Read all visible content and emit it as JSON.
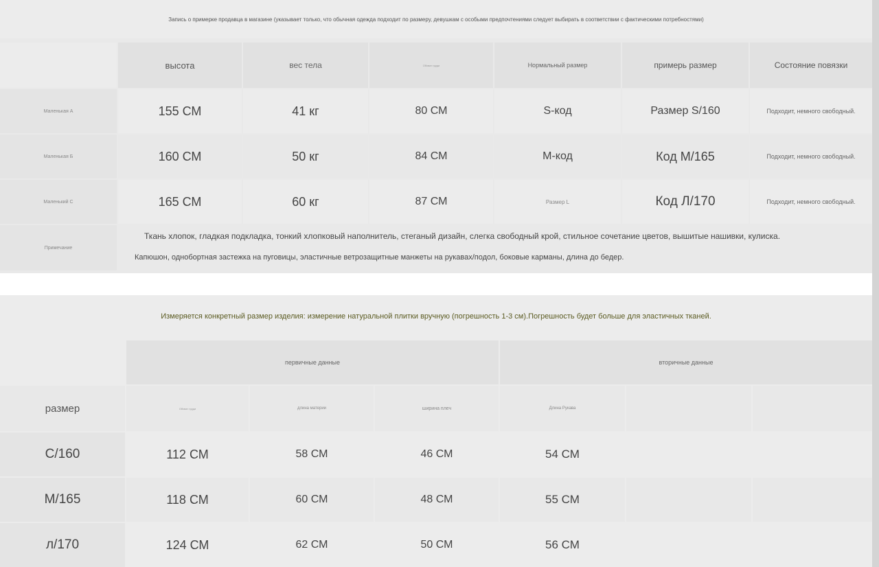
{
  "table1": {
    "title": "Запись о примерке продавца в магазине (указывает только, что обычная одежда подходит по размеру, девушкам с особыми предпочтениями следует выбирать в соответствии с фактическими потребностями)",
    "headers": [
      "высота",
      "вес тела",
      "Обхват груди",
      "Нормальный размер",
      "примерь размер",
      "Состояние повязки"
    ],
    "rows": [
      {
        "label": "Маленькая А",
        "height": "155 СМ",
        "weight": "41 кг",
        "bust": "80 СМ",
        "normal": "S-код",
        "tryon": "Размер S/160",
        "status": "Подходит, немного свободный."
      },
      {
        "label": "Маленькая Б",
        "height": "160 СМ",
        "weight": "50 кг",
        "bust": "84 СМ",
        "normal": "М-код",
        "tryon": "Код М/165",
        "status": "Подходит, немного свободный."
      },
      {
        "label": "Маленький С",
        "height": "165 СМ",
        "weight": "60 кг",
        "bust": "87 СМ",
        "normal": "Размер L",
        "tryon": "Код Л/170",
        "status": "Подходит, немного свободный."
      }
    ],
    "note_label": "Примечание",
    "note_line1": "Ткань хлопок, гладкая подкладка, тонкий хлопковый наполнитель, стеганый дизайн, слегка свободный крой, стильное сочетание цветов, вышитые нашивки, кулиска.",
    "note_line2": "Капюшон, однобортная застежка на пуговицы, эластичные ветрозащитные манжеты на рукавах/подол, боковые карманы, длина до бедер."
  },
  "table2": {
    "title": "Измеряется конкретный размер изделия: измерение натуральной плитки вручную (погрешность 1-3 см).Погрешность будет больше для эластичных тканей.",
    "group_primary": "первичные данные",
    "group_secondary": "вторичные данные",
    "headers": [
      "размер",
      "Обхват груди",
      "длина материи",
      "ширина плеч",
      "Длина Рукава",
      "",
      ""
    ],
    "rows": [
      {
        "size": "С/160",
        "bust": "112 СМ",
        "length": "58 СМ",
        "shoulder": "46 СМ",
        "sleeve": "54 СМ"
      },
      {
        "size": "М/165",
        "bust": "118 СМ",
        "length": "60 СМ",
        "shoulder": "48 СМ",
        "sleeve": "55 СМ"
      },
      {
        "size": "л/170",
        "bust": "124 СМ",
        "length": "62 СМ",
        "shoulder": "50 СМ",
        "sleeve": "56 СМ"
      }
    ]
  }
}
